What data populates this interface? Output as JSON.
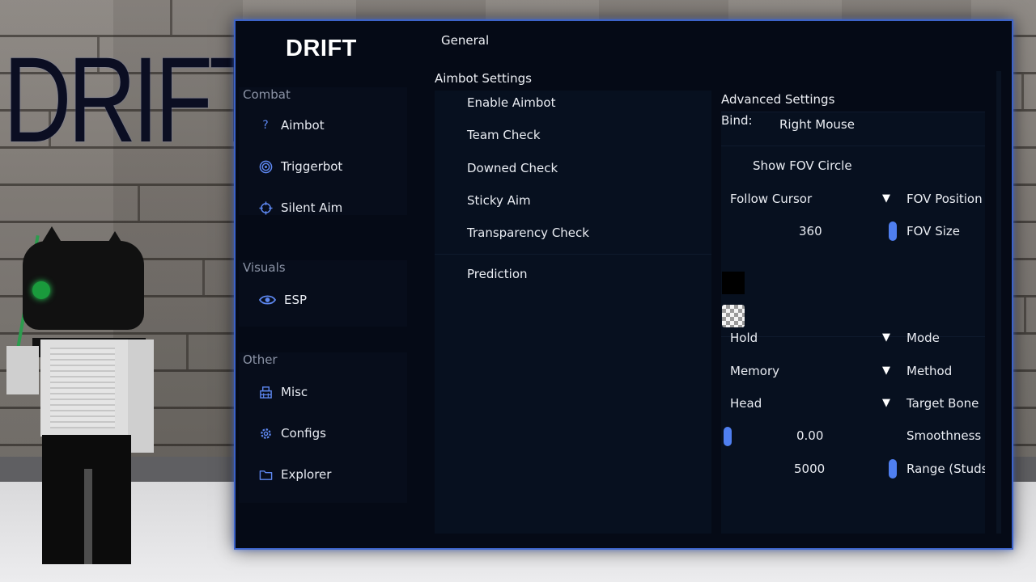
{
  "background": {
    "logo_text": "DRIFT"
  },
  "brand": {
    "title": "DRIFT",
    "accent": "#3c63c9"
  },
  "sidebar": {
    "groups": [
      {
        "label": "Combat",
        "items": [
          {
            "label": "Aimbot",
            "icon": "question-icon"
          },
          {
            "label": "Triggerbot",
            "icon": "target-icon"
          },
          {
            "label": "Silent Aim",
            "icon": "crosshair-icon"
          }
        ]
      },
      {
        "label": "Visuals",
        "items": [
          {
            "label": "ESP",
            "icon": "eye-icon"
          }
        ]
      },
      {
        "label": "Other",
        "items": [
          {
            "label": "Misc",
            "icon": "misc-icon"
          },
          {
            "label": "Configs",
            "icon": "gear-icon"
          },
          {
            "label": "Explorer",
            "icon": "folder-icon"
          }
        ]
      }
    ]
  },
  "tabs": {
    "general": "General"
  },
  "aimbot_settings": {
    "title": "Aimbot Settings",
    "options": [
      "Enable Aimbot",
      "Team Check",
      "Downed Check",
      "Sticky Aim",
      "Transparency Check"
    ],
    "prediction": "Prediction"
  },
  "advanced_settings": {
    "title": "Advanced Settings",
    "bind_label": "Bind:",
    "bind_value": "Right Mouse",
    "show_fov": "Show FOV Circle",
    "fov_position": {
      "value": "Follow Cursor",
      "label": "FOV Position"
    },
    "fov_size": {
      "value": "360",
      "label": "FOV Size"
    },
    "fov_color": "#000000",
    "mode": {
      "value": "Hold",
      "label": "Mode"
    },
    "method": {
      "value": "Memory",
      "label": "Method"
    },
    "target_bone": {
      "value": "Head",
      "label": "Target Bone"
    },
    "smoothness": {
      "value": "0.00",
      "label": "Smoothness"
    },
    "range": {
      "value": "5000",
      "label": "Range (Studs"
    }
  }
}
